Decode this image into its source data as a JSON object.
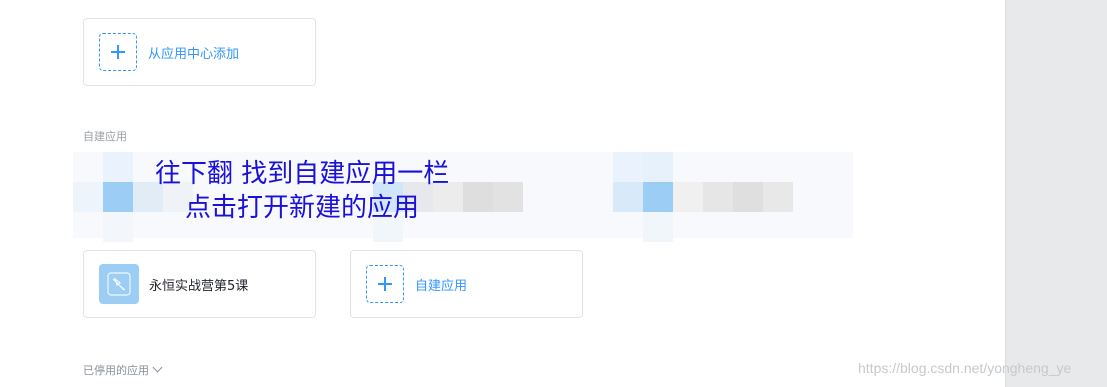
{
  "add_from_center": {
    "label": "从应用中心添加"
  },
  "custom_section": {
    "title": "自建应用"
  },
  "apps": [
    {
      "name": "永恒实战营第5课"
    }
  ],
  "create_app": {
    "label": "自建应用"
  },
  "disabled_section": {
    "title": "已停用的应用"
  },
  "annotation": {
    "line1": "往下翻 找到自建应用一栏",
    "line2": "点击打开新建的应用"
  },
  "watermark": "https://blog.csdn.net/yongheng_ye",
  "colors": {
    "accent": "#3296fa",
    "annotation": "#1a10d8",
    "app_icon": "#9ccdf5"
  },
  "icons": [
    "plus-icon",
    "app-icon",
    "chevron-down-icon"
  ]
}
